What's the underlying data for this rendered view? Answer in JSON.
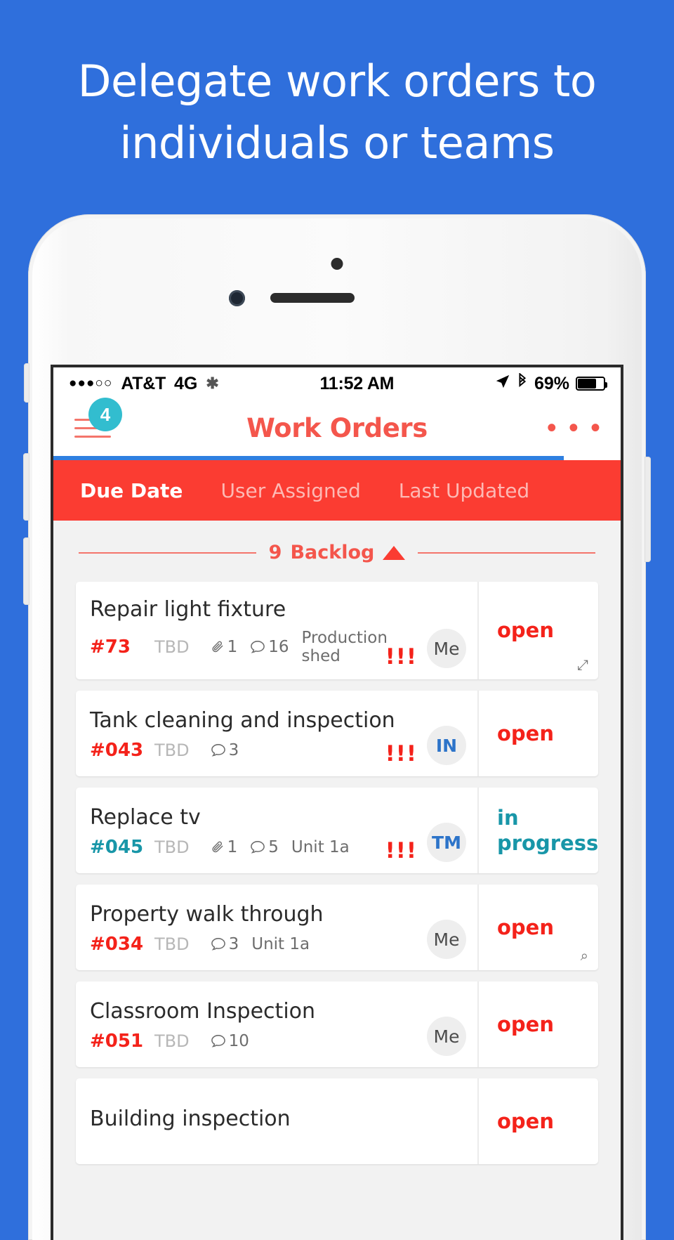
{
  "headline": "Delegate work orders to individuals or teams",
  "colors": {
    "background": "#2f6fdc",
    "brand_red": "#fb3c32",
    "accent_salmon": "#f4756b",
    "badge_teal": "#32bdcf",
    "status_teal": "#1896a8",
    "loading_blue": "#2f7fe0"
  },
  "status_bar": {
    "signal_dots": "●●●○○",
    "carrier": "AT&T",
    "network": "4G",
    "activity_icon": "spinner-icon",
    "time": "11:52 AM",
    "location_icon": "location-arrow-icon",
    "bluetooth_icon": "bluetooth-icon",
    "battery_percent": "69%",
    "battery_icon": "battery-icon"
  },
  "nav": {
    "menu_icon": "hamburger-menu-icon",
    "menu_badge": "4",
    "title": "Work Orders",
    "overflow_icon": "more-options-icon",
    "overflow_label": "• • •"
  },
  "loading": {
    "progress_percent": 90
  },
  "tabs": [
    {
      "label": "Due Date",
      "active": true
    },
    {
      "label": "User Assigned",
      "active": false
    },
    {
      "label": "Last Updated",
      "active": false
    }
  ],
  "section": {
    "count": "9",
    "label": "Backlog",
    "collapse_icon": "caret-up-icon"
  },
  "cards": [
    {
      "title": "Repair light fixture",
      "id": "#73",
      "id_color": "red",
      "due": "TBD",
      "attachments": "1",
      "comments": "16",
      "location": "Production shed",
      "priority": "!!!",
      "avatar": "Me",
      "avatar_color": "gray",
      "status": "open",
      "status_color": "red",
      "corner_icon": "expand-icon",
      "corner_glyph": "⤢"
    },
    {
      "title": "Tank cleaning and inspection",
      "id": "#043",
      "id_color": "red",
      "due": "TBD",
      "attachments": "",
      "comments": "3",
      "location": "",
      "priority": "!!!",
      "avatar": "IN",
      "avatar_color": "blue",
      "status": "open",
      "status_color": "red",
      "corner_icon": "",
      "corner_glyph": ""
    },
    {
      "title": "Replace tv",
      "id": "#045",
      "id_color": "teal",
      "due": "TBD",
      "attachments": "1",
      "comments": "5",
      "location": "Unit 1a",
      "priority": "!!!",
      "avatar": "TM",
      "avatar_color": "blue",
      "status": "in progress",
      "status_color": "teal",
      "corner_icon": "",
      "corner_glyph": ""
    },
    {
      "title": "Property walk through",
      "id": "#034",
      "id_color": "red",
      "due": "TBD",
      "attachments": "",
      "comments": "3",
      "location": "Unit 1a",
      "priority": "",
      "avatar": "Me",
      "avatar_color": "gray",
      "status": "open",
      "status_color": "red",
      "corner_icon": "search-icon",
      "corner_glyph": "⌕"
    },
    {
      "title": "Classroom Inspection",
      "id": "#051",
      "id_color": "red",
      "due": "TBD",
      "attachments": "",
      "comments": "10",
      "location": "",
      "priority": "",
      "avatar": "Me",
      "avatar_color": "gray",
      "status": "open",
      "status_color": "red",
      "corner_icon": "",
      "corner_glyph": ""
    },
    {
      "title": "Building inspection",
      "id": "",
      "id_color": "red",
      "due": "",
      "attachments": "",
      "comments": "",
      "location": "",
      "priority": "",
      "avatar": "",
      "avatar_color": "gray",
      "status": "open",
      "status_color": "red",
      "corner_icon": "",
      "corner_glyph": ""
    }
  ]
}
